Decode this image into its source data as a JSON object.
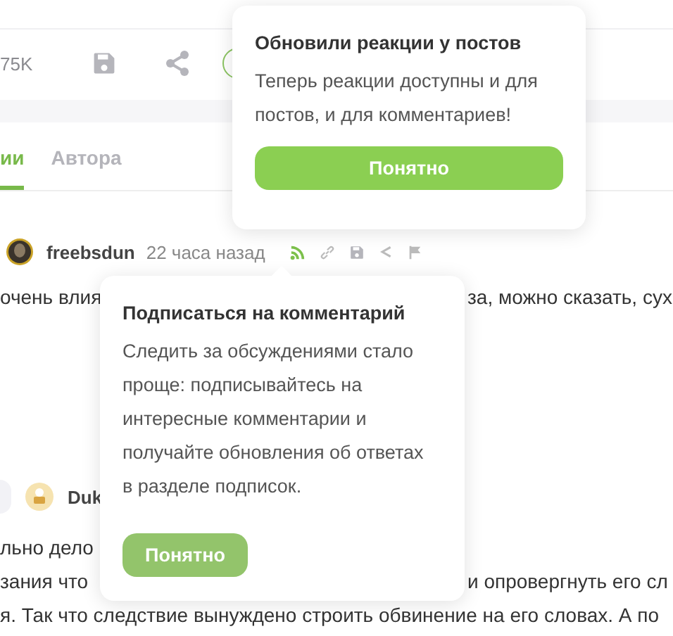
{
  "toolbar": {
    "count": "75K"
  },
  "tabs": [
    {
      "label": "ии",
      "selected": true
    },
    {
      "label": "Автора",
      "selected": false
    }
  ],
  "comment": {
    "author": "freebsdun",
    "time": "22 часа назад"
  },
  "line_1": {
    "left": "очень влия",
    "right": "за, можно сказать, сух"
  },
  "reply": {
    "author": "Duk"
  },
  "lines": [
    {
      "left": "льно дело"
    },
    {
      "left": "зания что",
      "right": "и опровергнуть его сл"
    },
    {
      "left": "я. Так что следствие вынуждено строить обвинение на его словах. А по"
    }
  ],
  "popovers": [
    {
      "kind": "top",
      "title": "Обновили реакции у постов",
      "text": "Теперь реакции доступны и для постов, и для комментариев!",
      "button": "Понятно"
    },
    {
      "kind": "comment",
      "title": "Подписаться на комментарий",
      "text": "Следить за обсуждениями стало проще: подписывайтесь на интересные комментарии и получайте обновления об ответах в разделе подписок.",
      "button": "Понятно"
    }
  ]
}
